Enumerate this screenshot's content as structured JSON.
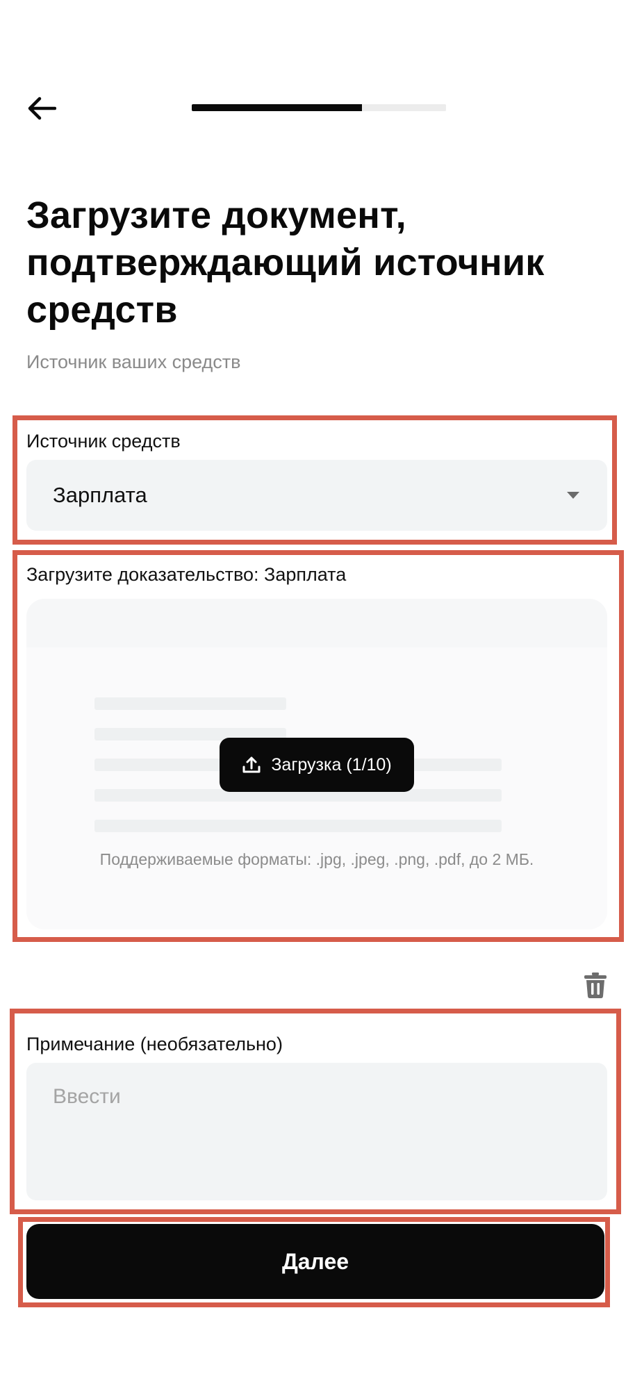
{
  "header": {
    "back_icon": "arrow-left-icon",
    "progress_fraction": 0.67
  },
  "page": {
    "title": "Загрузите документ, подтверждающий источник средств",
    "subtitle": "Источник ваших средств"
  },
  "source": {
    "label": "Источник средств",
    "selected": "Зарплата",
    "dropdown_icon": "caret-down-icon"
  },
  "upload": {
    "label": "Загрузите доказательство: Зарплата",
    "button_label": "Загрузка (1/10)",
    "button_icon": "upload-icon",
    "formats_text": "Поддерживаемые форматы: .jpg, .jpeg, .png, .pdf, до 2 МБ.",
    "delete_icon": "trash-icon"
  },
  "note": {
    "label": "Примечание (необязательно)",
    "placeholder": "Ввести",
    "value": ""
  },
  "actions": {
    "next_label": "Далее"
  },
  "colors": {
    "accent": "#0a0a0a",
    "highlight": "#d65c4a",
    "field_bg": "#f2f4f5",
    "muted_text": "#8a8a8a"
  }
}
